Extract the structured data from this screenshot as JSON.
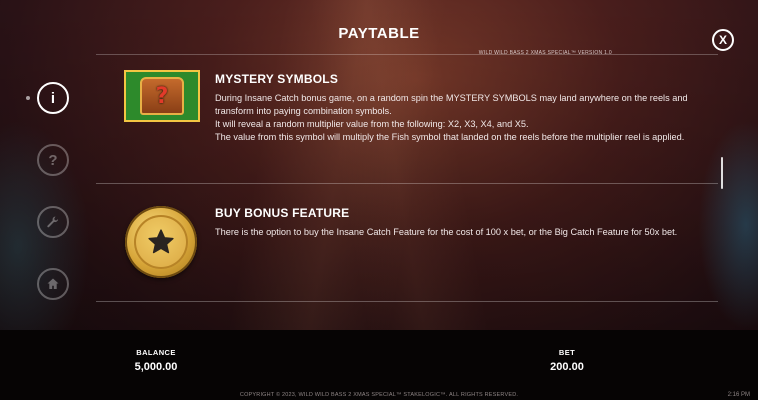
{
  "header": {
    "title": "PAYTABLE",
    "version": "WILD WILD BASS 2 XMAS SPECIAL™ VERSION 1.0",
    "close_label": "X"
  },
  "sidebar": {
    "items": [
      {
        "name": "info",
        "label": "i",
        "active": true
      },
      {
        "name": "help",
        "label": "?",
        "active": false
      },
      {
        "name": "settings",
        "label": "",
        "active": false
      },
      {
        "name": "home",
        "label": "",
        "active": false
      }
    ]
  },
  "sections": [
    {
      "icon": "mystery-chest-icon",
      "title": "MYSTERY SYMBOLS",
      "paragraphs": [
        "During Insane Catch bonus game, on a random spin the MYSTERY SYMBOLS may land anywhere on the reels and transform into paying combination symbols.",
        "It will reveal a random multiplier value from the following: X2, X3, X4, and X5.",
        "The value from this symbol will multiply the Fish symbol that landed on the reels before the multiplier reel is applied."
      ]
    },
    {
      "icon": "gold-star-coin-icon",
      "title": "BUY BONUS FEATURE",
      "paragraphs": [
        "There is the option to buy the Insane Catch Feature for the cost of 100 x bet, or the Big Catch Feature for 50x bet."
      ]
    }
  ],
  "footer": {
    "balance_label": "BALANCE",
    "balance_value": "5,000.00",
    "bet_label": "BET",
    "bet_value": "200.00",
    "copyright": "COPYRIGHT © 2023, WILD WILD BASS 2 XMAS SPECIAL™ STAKELOGIC™. ALL RIGHTS RESERVED.",
    "time": "2:16 PM"
  },
  "colors": {
    "chest_frame": "#f3c643",
    "chest_bg": "#2d8a2b",
    "coin_gold": "#d6a437",
    "footer_bg": "#060404"
  }
}
